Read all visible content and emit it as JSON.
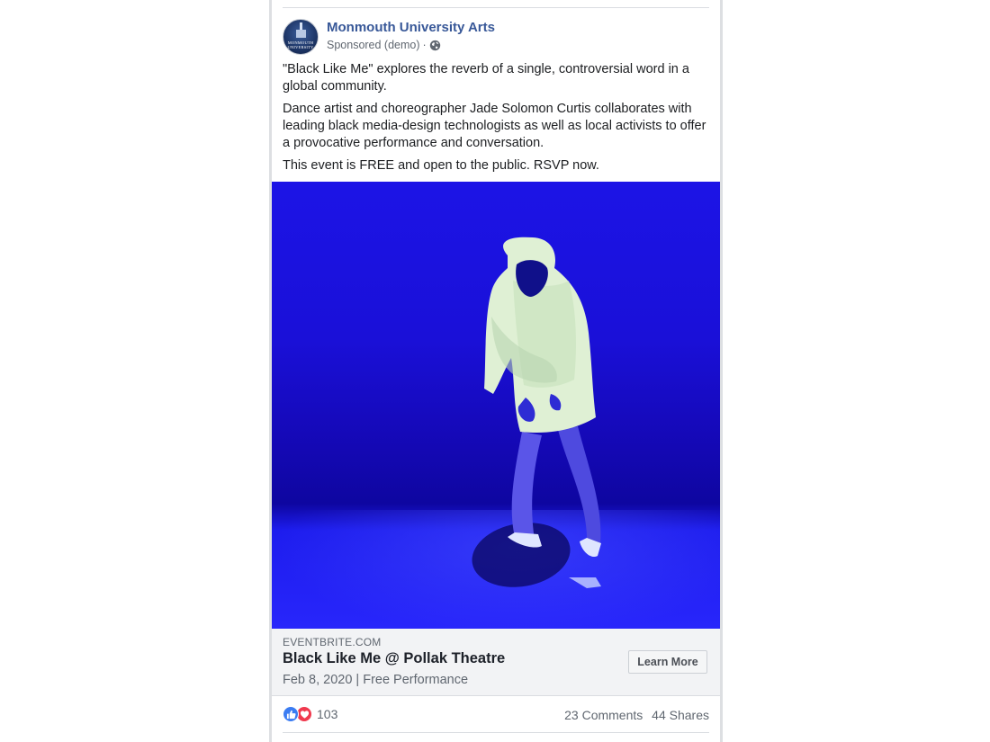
{
  "post": {
    "page_name": "Monmouth University Arts",
    "sponsored_label": "Sponsored (demo)",
    "separator": "·",
    "avatar_text": "MONMOUTH UNIVERSITY",
    "privacy_icon": "globe-icon",
    "paragraphs": [
      "\"Black Like Me\" explores the reverb of a single, controversial word in a global community.",
      "Dance artist and choreographer Jade Solomon Curtis collaborates with leading black media-design technologists as well as local activists to offer a provocative performance and conversation.",
      "This event is FREE and open to the public. RSVP now."
    ],
    "image": {
      "description_icon": "dancer-photo",
      "background_color": "#1a12dc"
    },
    "link": {
      "domain": "EVENTBRITE.COM",
      "title": "Black Like Me @ Pollak Theatre",
      "subtitle": "Feb 8, 2020 | Free Performance",
      "cta_label": "Learn More"
    },
    "engagement": {
      "reaction_icons": [
        "like-icon",
        "love-icon"
      ],
      "reaction_count": "103",
      "comments": "23 Comments",
      "shares": "44 Shares"
    }
  },
  "colors": {
    "link_blue": "#385898",
    "secondary_text": "#606770",
    "like_blue": "#3b7cf2",
    "love_red": "#f0394e"
  }
}
